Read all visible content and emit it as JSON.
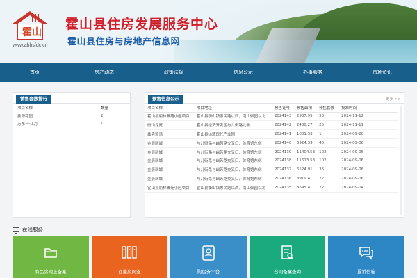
{
  "header": {
    "domain": "www.ahhsfdc.cn",
    "title": "霍山县住房发展服务中心",
    "subtitle": "霍山县住房与房地产信息网",
    "logo_mark": "霍山"
  },
  "nav": {
    "items": [
      "首页",
      "房产动态",
      "政策法规",
      "信息公示",
      "办事服务",
      "市场资讯"
    ]
  },
  "sales_rank": {
    "tab": "销售套数排行",
    "columns": [
      "项目名称",
      "数量"
    ],
    "rows": [
      [
        "鑫源花园",
        "2"
      ],
      [
        "万东·千江月",
        "1"
      ]
    ]
  },
  "presale": {
    "tab": "预售信息公示",
    "more": "更多 >>",
    "columns": [
      "项目名称",
      "项目地址",
      "预售证号",
      "预售面积",
      "预售套数",
      "批准时间"
    ],
    "rows": [
      [
        "霍山县丽林雅苑小区项目",
        "霍山县衡山镇惠民路以西，南山御园以北",
        "2024143",
        "2937.95",
        "50",
        "2024-11-12"
      ],
      [
        "衡山龙庭",
        "霍山县经济开发区与儿街路北侧",
        "2024142",
        "2400.27",
        "25",
        "2024-11-11"
      ],
      [
        "鑫秀蓝湾",
        "霍山县纺湾现代产业园",
        "2024141",
        "1001.33",
        "1",
        "2024-09-20"
      ],
      [
        "金辰新城",
        "与儿街路与幽芳路交叉口、体育馆东侧",
        "2024140",
        "6924.39",
        "40",
        "2024-09-06"
      ],
      [
        "金辰新城",
        "与儿街路与幽芳路交叉口、体育馆东侧",
        "2024139",
        "11404.53",
        "102",
        "2024-09-06"
      ],
      [
        "金辰新城",
        "与儿街路与幽芳路交叉口、体育馆东侧",
        "2024138",
        "11613.53",
        "102",
        "2024-09-06"
      ],
      [
        "金辰新城",
        "与儿街路与幽芳路交叉口、体育馆东侧",
        "2024137",
        "6524.91",
        "36",
        "2024-09-06"
      ],
      [
        "金辰新城",
        "与儿街路与幽芳路交叉口、体育馆东侧",
        "2024136",
        "3919.4",
        "22",
        "2024-09-06"
      ],
      [
        "霍山县丽林雅苑小区项目",
        "霍山县衡山镇惠民路以西，南山御园以北",
        "2024135",
        "3645.4",
        "22",
        "2024-09-04"
      ]
    ]
  },
  "services": {
    "title": "在线服务",
    "tiles": [
      {
        "label": "商品房网上备案",
        "color": "#70b743",
        "icon": "folder-icon"
      },
      {
        "label": "存量房网签",
        "color": "#e8641f",
        "icon": "archive-icon"
      },
      {
        "label": "购房券平台",
        "color": "#3a8fc9",
        "icon": "id-card-icon"
      },
      {
        "label": "合同备案查询",
        "color": "#1aaa7d",
        "icon": "document-search-icon"
      },
      {
        "label": "投诉信箱",
        "color": "#2d87c4",
        "icon": "chat-icon"
      }
    ]
  }
}
